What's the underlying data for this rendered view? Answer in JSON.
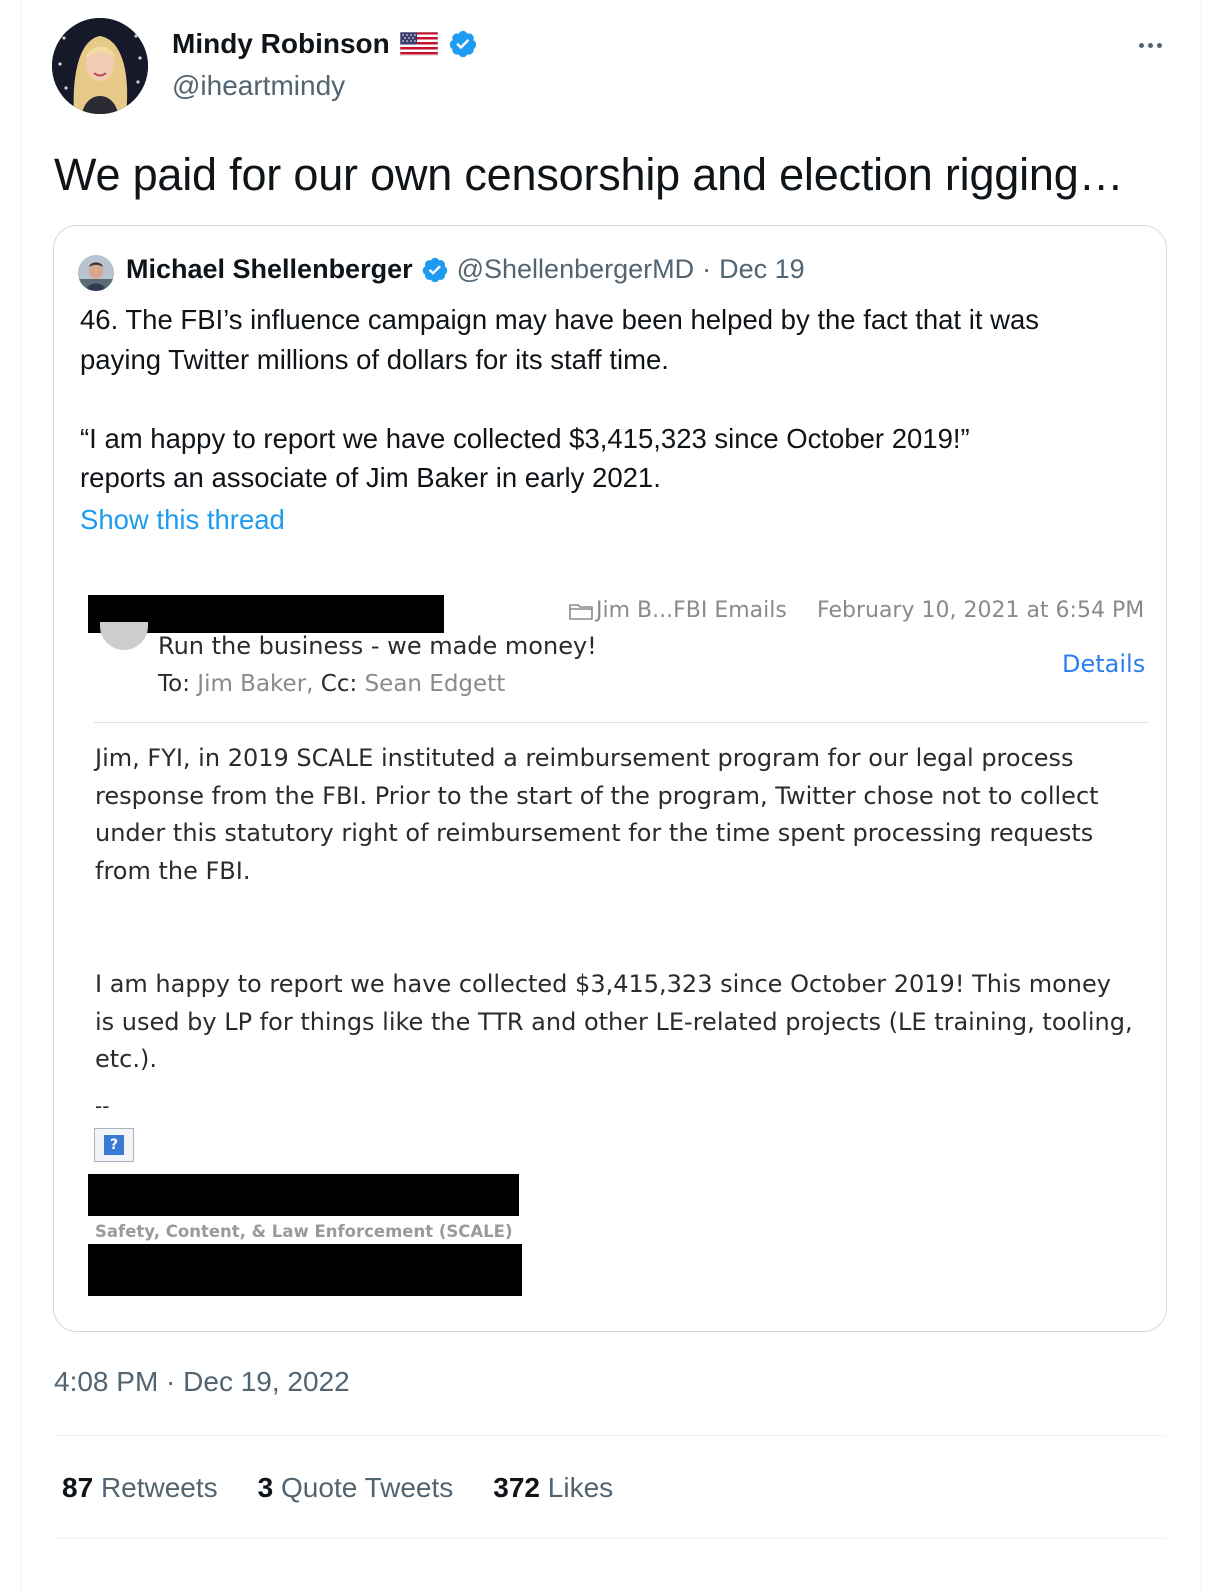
{
  "tweet": {
    "author_name": "Mindy Robinson",
    "author_handle": "@iheartmindy",
    "text": "We paid for our own censorship and election rigging…",
    "timestamp": "4:08 PM · Dec 19, 2022"
  },
  "quoted_tweet": {
    "author_name": "Michael Shellenberger",
    "author_handle": "@ShellenbergerMD",
    "separator": "·",
    "date": "Dec 19",
    "text_lines": [
      "46. The FBI’s influence campaign may have been helped by the fact that it was",
      "paying Twitter millions of dollars for its staff time.",
      "",
      "“I am happy to report we have collected $3,415,323 since October 2019!”",
      "reports an associate of Jim Baker in early 2021."
    ],
    "show_thread": "Show this thread"
  },
  "email": {
    "folder": "Jim B...FBI Emails",
    "date": "February 10, 2021 at 6:54 PM",
    "subject": "Run the business - we made money!",
    "to_label": "To:",
    "to_value": "Jim Baker,",
    "cc_label": "Cc:",
    "cc_value": "Sean Edgett",
    "details": "Details",
    "body_para1": [
      "Jim, FYI, in 2019 SCALE instituted a reimbursement program for our legal process",
      "response from the FBI.  Prior to the start of the program, Twitter chose not to collect",
      "under this statutory right of reimbursement for the time spent processing requests",
      "from the FBI."
    ],
    "body_para2": [
      "I am happy to report we have collected $3,415,323 since October 2019!  This money",
      "is used by LP for things like the TTR and other LE-related projects (LE training, tooling,",
      "etc.)."
    ],
    "signature_dash": "--",
    "missing_image": "?",
    "signature_dept": "Safety, Content, & Law Enforcement (SCALE)"
  },
  "stats": [
    {
      "count": "87",
      "label": "Retweets"
    },
    {
      "count": "3",
      "label": "Quote Tweets"
    },
    {
      "count": "372",
      "label": "Likes"
    }
  ],
  "colors": {
    "link_blue": "#1d9bf0",
    "verified_blue": "#1d9bf0",
    "secondary_text": "#536471",
    "email_link": "#2c7ef0"
  }
}
